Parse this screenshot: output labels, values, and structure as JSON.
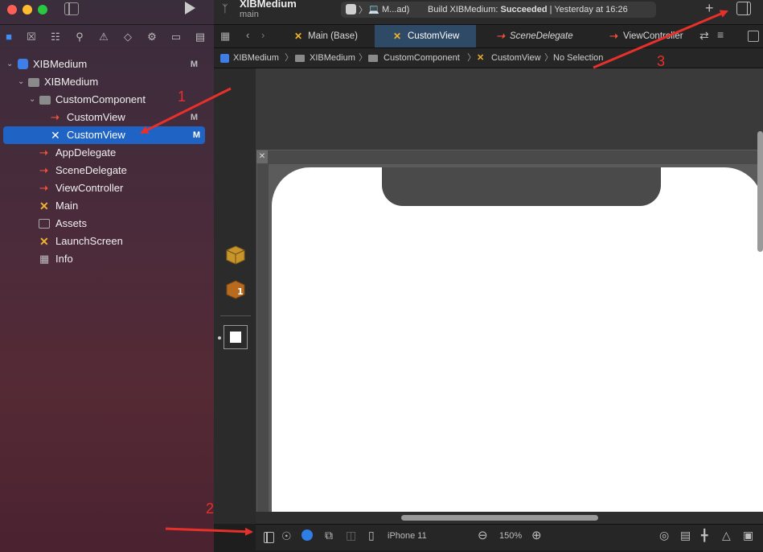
{
  "window": {
    "project_title": "XIBMedium",
    "branch": "main",
    "scheme": "M...ad)",
    "build_status_prefix": "Build XIBMedium: ",
    "build_status_result": "Succeeded",
    "build_status_time": "| Yesterday at 16:26"
  },
  "navigator": {
    "items": [
      {
        "label": "XIBMedium",
        "badge": "M"
      },
      {
        "label": "XIBMedium"
      },
      {
        "label": "CustomComponent"
      },
      {
        "label": "CustomView",
        "badge": "M"
      },
      {
        "label": "CustomView",
        "badge": "M"
      },
      {
        "label": "AppDelegate"
      },
      {
        "label": "SceneDelegate"
      },
      {
        "label": "ViewController"
      },
      {
        "label": "Main"
      },
      {
        "label": "Assets"
      },
      {
        "label": "LaunchScreen"
      },
      {
        "label": "Info"
      }
    ]
  },
  "tabs": [
    {
      "label": "Main (Base)"
    },
    {
      "label": "CustomView"
    },
    {
      "label": "SceneDelegate"
    },
    {
      "label": "ViewController"
    }
  ],
  "jumpbar": {
    "items": [
      "XIBMedium",
      "XIBMedium",
      "CustomComponent",
      "CustomView",
      "No Selection"
    ]
  },
  "bottombar": {
    "device": "iPhone 11",
    "zoom": "150%"
  },
  "annotations": {
    "one": "1",
    "two": "2",
    "three": "3"
  },
  "colors": {
    "accent_selection": "#1f63c4",
    "annotation_red": "#e8302a",
    "swift_orange": "#f05138",
    "xib_yellow": "#f0b430"
  }
}
